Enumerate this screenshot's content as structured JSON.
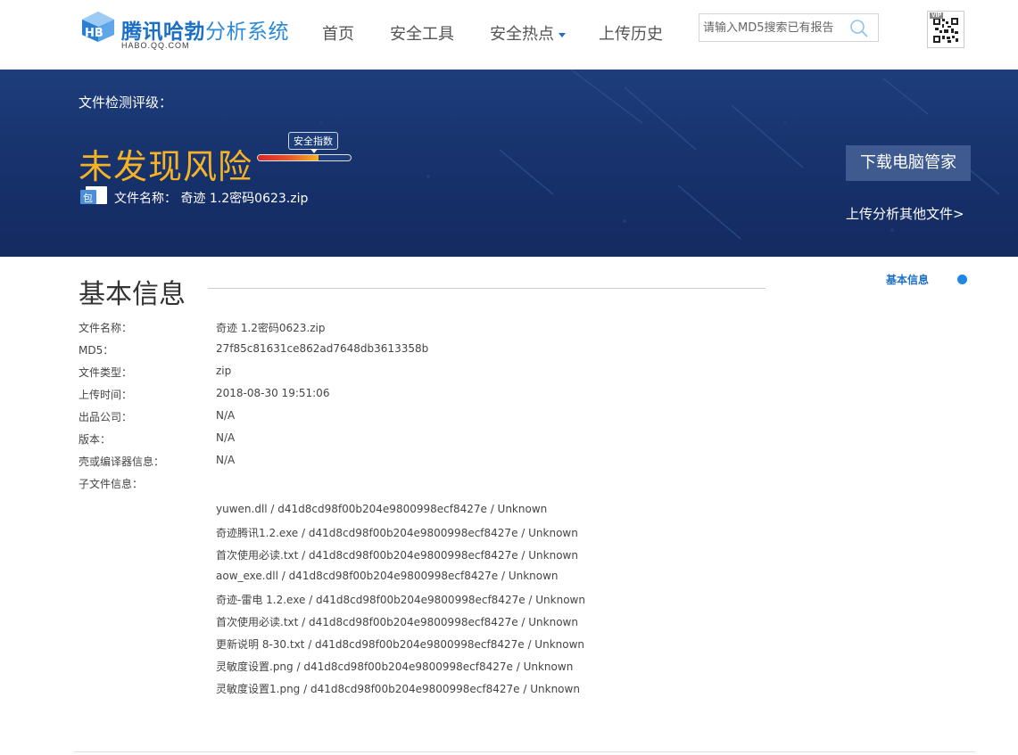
{
  "header": {
    "logo_main": "腾讯哈勃",
    "logo_suffix": "分析系统",
    "logo_sub": "HABO.QQ.COM",
    "nav": [
      {
        "label": "首页",
        "has_dropdown": false
      },
      {
        "label": "安全工具",
        "has_dropdown": false
      },
      {
        "label": "安全热点",
        "has_dropdown": true
      },
      {
        "label": "上传历史",
        "has_dropdown": false
      }
    ],
    "search_placeholder": "请输入MD5搜索已有报告",
    "qr_badge": "VIP"
  },
  "banner": {
    "label": "文件检测评级：",
    "risk": "未发现风险",
    "gauge_tip": "安全指数",
    "gauge_level": 0.65,
    "file_icon_text": "包",
    "file_label": "文件名称：  奇迹 1.2密码0623.zip",
    "download_button": "下载电脑管家",
    "upload_link": "上传分析其他文件>"
  },
  "colors": {
    "brand": "#1c6fc6",
    "banner_bg": "#1d3d7b",
    "risk": "#f6b324"
  },
  "section": {
    "title": "基本信息",
    "side_nav": "基本信息"
  },
  "info": [
    {
      "key": "文件名称：",
      "value": "奇迹 1.2密码0623.zip"
    },
    {
      "key": "MD5：",
      "value": "27f85c81631ce862ad7648db3613358b"
    },
    {
      "key": "文件类型：",
      "value": "zip"
    },
    {
      "key": "上传时间：",
      "value": "2018-08-30 19:51:06"
    },
    {
      "key": "出品公司：",
      "value": "N/A"
    },
    {
      "key": "版本：",
      "value": "N/A"
    },
    {
      "key": "壳或编译器信息：",
      "value": "N/A"
    },
    {
      "key": "子文件信息：",
      "value": ""
    }
  ],
  "sub_files": [
    "yuwen.dll /  d41d8cd98f00b204e9800998ecf8427e /  Unknown",
    "奇迹腾讯1.2.exe /  d41d8cd98f00b204e9800998ecf8427e /  Unknown",
    "首次使用必读.txt /  d41d8cd98f00b204e9800998ecf8427e /  Unknown",
    "aow_exe.dll /  d41d8cd98f00b204e9800998ecf8427e /  Unknown",
    "奇迹-雷电 1.2.exe /  d41d8cd98f00b204e9800998ecf8427e /  Unknown",
    "首次使用必读.txt /  d41d8cd98f00b204e9800998ecf8427e /  Unknown",
    "更新说明 8-30.txt /  d41d8cd98f00b204e9800998ecf8427e /  Unknown",
    "灵敏度设置.png /  d41d8cd98f00b204e9800998ecf8427e /  Unknown",
    "灵敏度设置1.png /  d41d8cd98f00b204e9800998ecf8427e /  Unknown"
  ]
}
